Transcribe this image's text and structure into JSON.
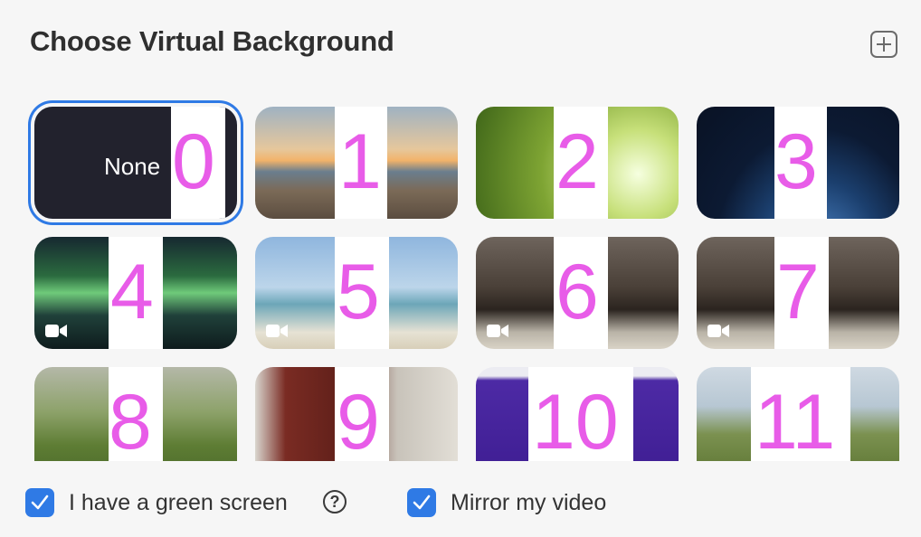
{
  "dialog": {
    "title": "Choose Virtual Background",
    "add_icon": "plus-icon"
  },
  "backgrounds": [
    {
      "label": "None",
      "number": "0",
      "selected": true
    },
    {
      "label": "",
      "number": "1",
      "has_video": false
    },
    {
      "label": "",
      "number": "2",
      "has_video": false
    },
    {
      "label": "",
      "number": "3",
      "has_video": false
    },
    {
      "label": "",
      "number": "4",
      "has_video": true
    },
    {
      "label": "",
      "number": "5",
      "has_video": true
    },
    {
      "label": "",
      "number": "6",
      "has_video": true
    },
    {
      "label": "",
      "number": "7",
      "has_video": true
    },
    {
      "label": "",
      "number": "8",
      "has_video": true
    },
    {
      "label": "",
      "number": "9",
      "has_video": false
    },
    {
      "label": "",
      "number": "10",
      "has_video": false
    },
    {
      "label": "",
      "number": "11",
      "has_video": false
    }
  ],
  "options": {
    "green_screen": {
      "label": "I have a green screen",
      "checked": true,
      "help_icon": "question-icon",
      "help_text": "?"
    },
    "mirror": {
      "label": "Mirror my video",
      "checked": true
    }
  },
  "colors": {
    "accent": "#2f7ae5",
    "number_overlay": "#e85ce8"
  }
}
